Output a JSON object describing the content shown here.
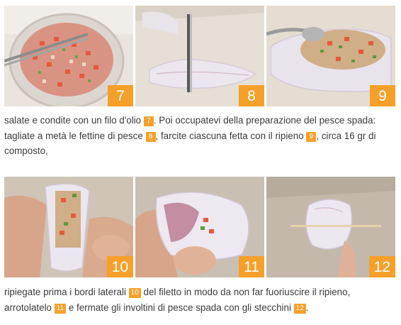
{
  "steps": [
    {
      "number": "7"
    },
    {
      "number": "8"
    },
    {
      "number": "9"
    },
    {
      "number": "10"
    },
    {
      "number": "11"
    },
    {
      "number": "12"
    }
  ],
  "paragraph1": {
    "t1": "salate e condite con un filo d'olio ",
    "n1": "7",
    "t2": ". Poi occupatevi della preparazione del pesce spada: tagliate a metà le fettine di pesce ",
    "n2": "8",
    "t3": ", farcite ciascuna fetta con il ripieno ",
    "n3": "9",
    "t4": ", circa 16 gr di composto,"
  },
  "paragraph2": {
    "t1": "ripiegate prima i bordi laterali ",
    "n1": "10",
    "t2": " del filetto in modo da non far fuoriuscire il ripieno, arrotolatelo ",
    "n2": "11",
    "t3": " e fermate gli involtini di pesce spada con gli stecchini ",
    "n3": "12",
    "t4": "."
  },
  "colors": {
    "accent": "#f5a02a",
    "text": "#3a3a3a"
  }
}
